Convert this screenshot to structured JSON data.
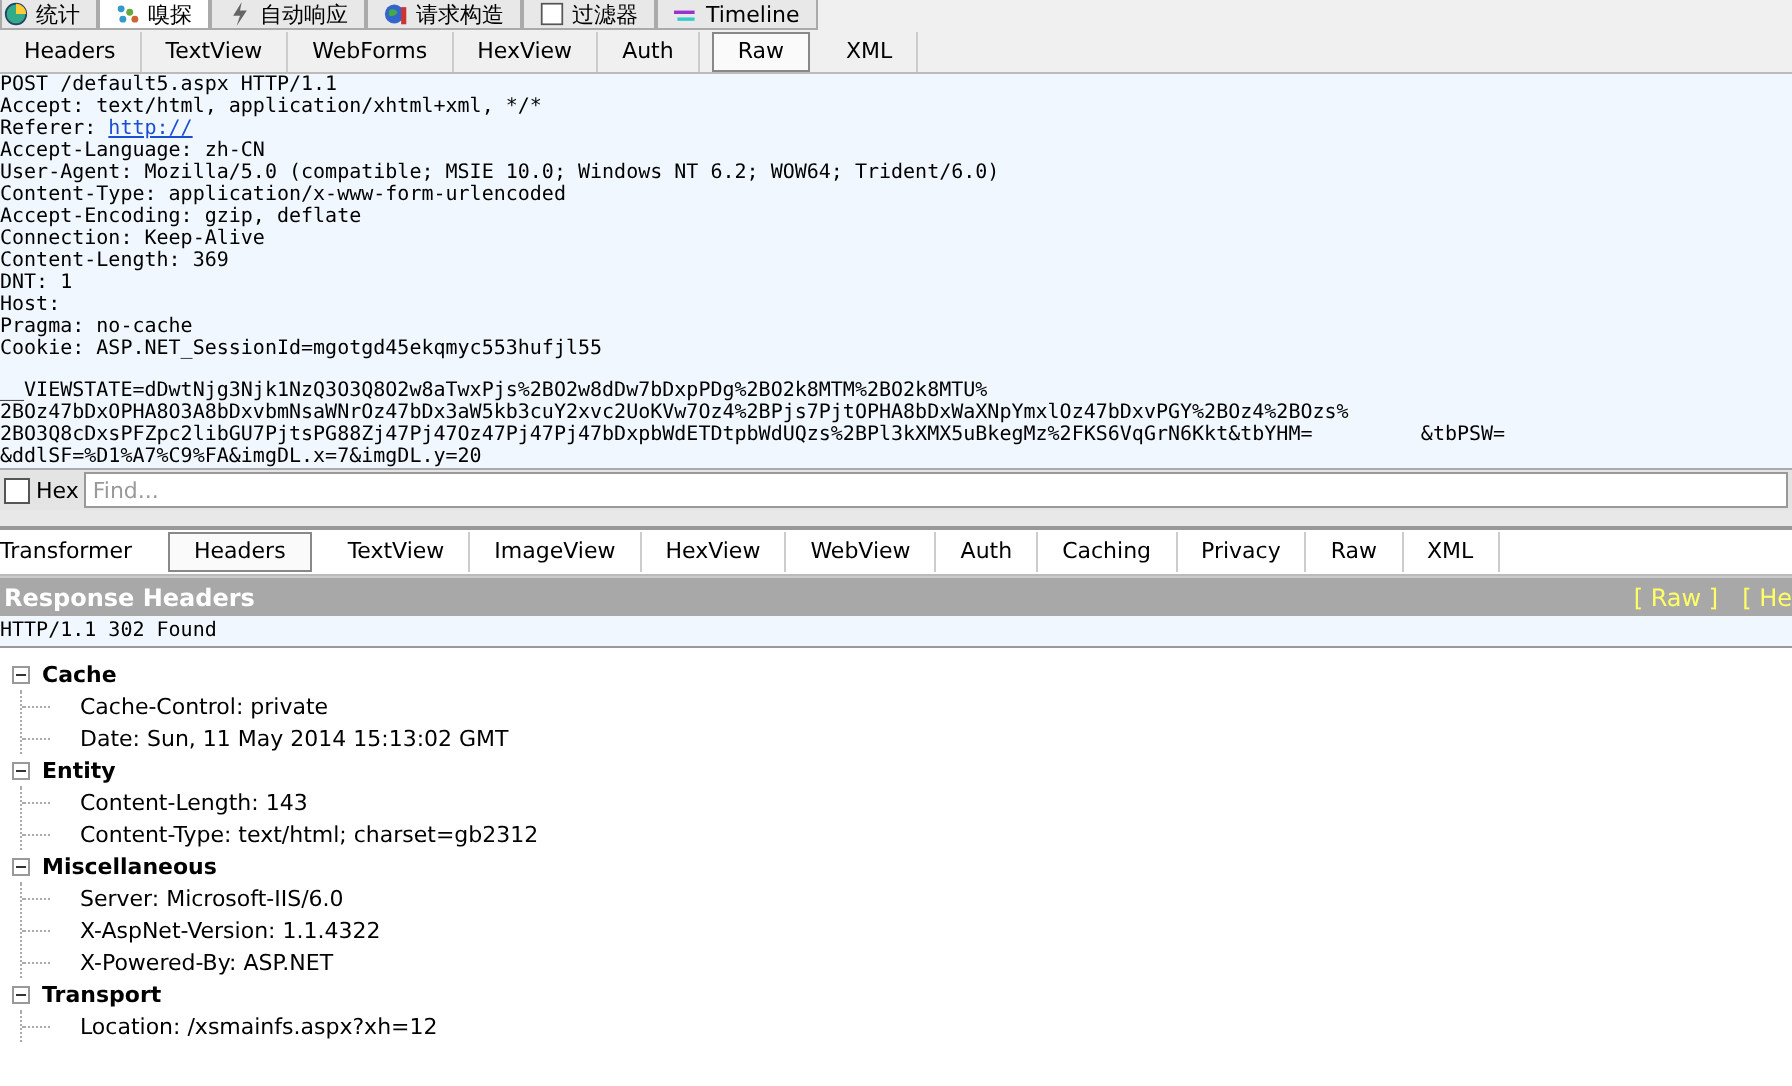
{
  "top_tabs": [
    {
      "label": "统计",
      "selected": false
    },
    {
      "label": "嗅探",
      "selected": true
    },
    {
      "label": "自动响应",
      "selected": false
    },
    {
      "label": "请求构造",
      "selected": false
    },
    {
      "label": "过滤器",
      "selected": false
    },
    {
      "label": "Timeline",
      "selected": false
    }
  ],
  "request_tabs": [
    {
      "label": "Headers",
      "selected": false
    },
    {
      "label": "TextView",
      "selected": false
    },
    {
      "label": "WebForms",
      "selected": false
    },
    {
      "label": "HexView",
      "selected": false
    },
    {
      "label": "Auth",
      "selected": false
    },
    {
      "label": "Raw",
      "selected": true
    },
    {
      "label": "XML",
      "selected": false
    }
  ],
  "request_raw": {
    "lines": [
      {
        "kind": "text",
        "text": "POST /default5.aspx HTTP/1.1"
      },
      {
        "kind": "text",
        "text": "Accept: text/html, application/xhtml+xml, */*"
      },
      {
        "kind": "link",
        "label": "Referer:",
        "url": "http://"
      },
      {
        "kind": "text",
        "text": "Accept-Language: zh-CN"
      },
      {
        "kind": "text",
        "text": "User-Agent: Mozilla/5.0 (compatible; MSIE 10.0; Windows NT 6.2; WOW64; Trident/6.0)"
      },
      {
        "kind": "text",
        "text": "Content-Type: application/x-www-form-urlencoded"
      },
      {
        "kind": "text",
        "text": "Accept-Encoding: gzip, deflate"
      },
      {
        "kind": "text",
        "text": "Connection: Keep-Alive"
      },
      {
        "kind": "text",
        "text": "Content-Length: 369"
      },
      {
        "kind": "text",
        "text": "DNT: 1"
      },
      {
        "kind": "text",
        "text": "Host:"
      },
      {
        "kind": "text",
        "text": "Pragma: no-cache"
      },
      {
        "kind": "text",
        "text": "Cookie: ASP.NET_SessionId=mgotgd45ekqmyc553hufjl55"
      },
      {
        "kind": "blank"
      },
      {
        "kind": "text",
        "text": "__VIEWSTATE=dDwtNjg3Njk1NzQ3O3Q8O2w8aTwxPjs%2BO2w8dDw7bDxpPDg%2BO2k8MTM%2BO2k8MTU%"
      },
      {
        "kind": "text",
        "text": "2BOz47bDxOPHA8O3A8bDxvbmNsaWNrOz47bDx3aW5kb3cuY2xvc2UoKVw7Oz4%2BPjs7PjtOPHA8bDxWaXNpYmxlOz47bDxvPGY%2BOz4%2BOzs%"
      },
      {
        "kind": "text",
        "text": "2BO3Q8cDxsPFZpc2libGU7PjtsPG88Zj47Pj47Oz47Pj47Pj47bDxpbWdETDtpbWdUQzs%2BPl3kXMX5uBkegMz%2FKS6VqGrN6Kkt&tbYHM=         &tbPSW="
      },
      {
        "kind": "text",
        "text": "&ddlSF=%D1%A7%C9%FA&imgDL.x=7&imgDL.y=20"
      }
    ]
  },
  "find_bar": {
    "hex_label": "Hex",
    "hex_checked": false,
    "placeholder": "Find..."
  },
  "response_tabs": [
    {
      "label": "Transformer",
      "selected": false
    },
    {
      "label": "Headers",
      "selected": true
    },
    {
      "label": "TextView",
      "selected": false
    },
    {
      "label": "ImageView",
      "selected": false
    },
    {
      "label": "HexView",
      "selected": false
    },
    {
      "label": "WebView",
      "selected": false
    },
    {
      "label": "Auth",
      "selected": false
    },
    {
      "label": "Caching",
      "selected": false
    },
    {
      "label": "Privacy",
      "selected": false
    },
    {
      "label": "Raw",
      "selected": false
    },
    {
      "label": "XML",
      "selected": false
    }
  ],
  "response_headers": {
    "title": "Response Headers",
    "links": [
      "[ Raw ]",
      "[ He"
    ],
    "status_line": "HTTP/1.1 302 Found",
    "groups": [
      {
        "name": "Cache",
        "expanded": true,
        "items": [
          "Cache-Control: private",
          "Date: Sun, 11 May 2014 15:13:02 GMT"
        ]
      },
      {
        "name": "Entity",
        "expanded": true,
        "items": [
          "Content-Length: 143",
          "Content-Type: text/html; charset=gb2312"
        ]
      },
      {
        "name": "Miscellaneous",
        "expanded": true,
        "items": [
          "Server: Microsoft-IIS/6.0",
          "X-AspNet-Version: 1.1.4322",
          "X-Powered-By: ASP.NET"
        ]
      },
      {
        "name": "Transport",
        "expanded": true,
        "items": [
          "Location: /xsmainfs.aspx?xh=12"
        ]
      }
    ]
  }
}
